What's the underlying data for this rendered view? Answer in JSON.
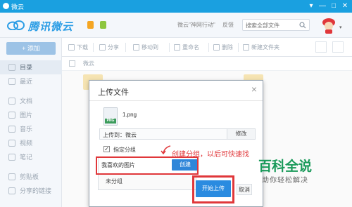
{
  "window": {
    "title": "微云",
    "buttons": [
      "▾",
      "—",
      "□",
      "✕"
    ]
  },
  "header": {
    "brand": "腾讯微云",
    "promo": "微云\"神网行动\"",
    "feedback": "反馈",
    "search_placeholder": "搜索全部文件",
    "avatar_caret": "▾"
  },
  "sidebar": {
    "upload_label": "+ 添加",
    "items": [
      {
        "label": "目录",
        "active": true
      },
      {
        "label": "最近"
      },
      {
        "label": "文档"
      },
      {
        "label": "图片"
      },
      {
        "label": "音乐"
      },
      {
        "label": "视频"
      },
      {
        "label": "笔记"
      },
      {
        "label": "剪贴板"
      },
      {
        "label": "分享的链接"
      }
    ]
  },
  "toolbar": {
    "download": "下载",
    "share": "分享",
    "move": "移动到",
    "rename": "重命名",
    "delete": "删除",
    "new_folder": "新建文件夹"
  },
  "breadcrumb": {
    "root": "微云"
  },
  "dialog": {
    "title": "上传文件",
    "close": "×",
    "file_icon_label": "PNG",
    "file_name": "1.png",
    "destination": "上传到：微云",
    "modify": "修改",
    "group_check": "✓",
    "group_label": "指定分组",
    "group_input_value": "我喜欢的图片",
    "create": "创建",
    "ungrouped": "未分组",
    "start_upload": "开始上传",
    "cancel": "取消"
  },
  "annotation": {
    "text": "创建分组，以后可快速找"
  },
  "watermark": {
    "title": "百科全说",
    "subtitle": "助你轻松解决"
  },
  "colors": {
    "brand": "#1aa0e0",
    "accent_button": "#2a8be0",
    "annotation_red": "#e0373a",
    "watermark_green": "#1a9a5a"
  }
}
